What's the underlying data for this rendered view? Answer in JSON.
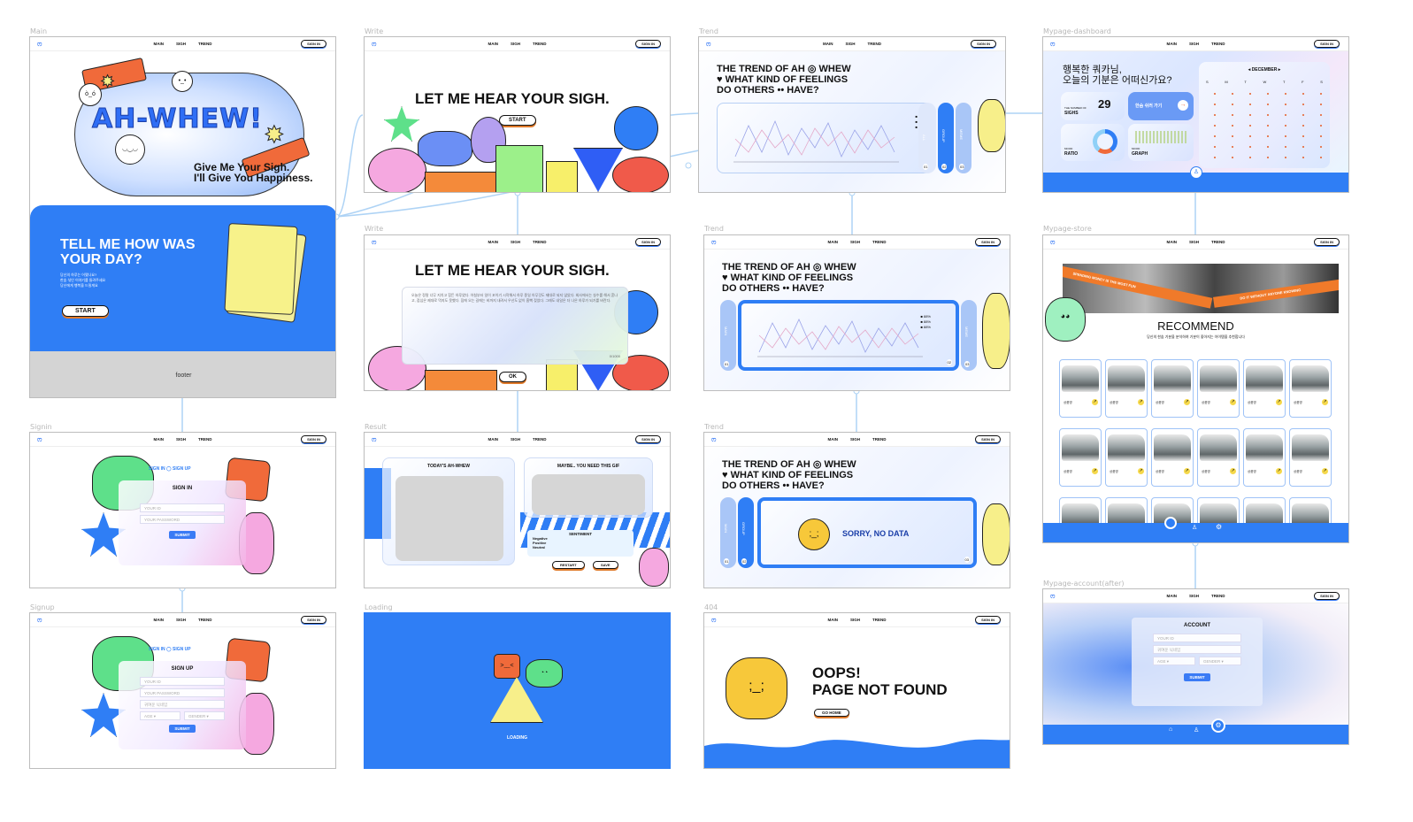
{
  "frame_labels": {
    "main": "Main",
    "write1": "Write",
    "trend1": "Trend",
    "dashboard": "Mypage-dashboard",
    "write2": "Write",
    "trend2": "Trend",
    "store": "Mypage-store",
    "signin": "Signin",
    "result": "Result",
    "trend3": "Trend",
    "signup": "Signup",
    "loading": "Loading",
    "notfound": "404",
    "account": "Mypage-account(after)"
  },
  "nav": {
    "main": "MAIN",
    "sigh": "SIGH",
    "trend": "TREND",
    "sign_in": "SIGN IN"
  },
  "main": {
    "title": "AH-WHEW!",
    "tagline1": "Give Me Your Sigh.",
    "tagline2": "I'll Give You Happiness.",
    "tell1": "TELL ME HOW WAS",
    "tell2": "YOUR DAY?",
    "small1": "당신의 하루는 어땠나요?",
    "small2": "한숨 섞인 이야기를 들려주세요",
    "small3": "당신에게 행복을 드릴게요",
    "start": "START",
    "footer": "footer"
  },
  "write": {
    "title": "LET ME HEAR YOUR SIGH.",
    "start": "START",
    "ok": "OK",
    "counter": "0/1000",
    "body": "오늘은 정말 너무 지치고 힘든 하루였다. 아침부터 일이 꼬이기 시작해서 하루 종일 아무것도 제대로 되지 않았다. 회사에서는 실수를 해서 혼나고, 점심은 제대로 먹지도 못했다. 집에 오는 길에는 비까지 내려서 우산도 없이 흠뻑 젖었다. 그래도 내일은 더 나은 하루가 되기를 바란다."
  },
  "trend": {
    "line1": "THE TREND OF AH",
    "line1b": "WHEW",
    "line2": "WHAT KIND OF FEELINGS",
    "line3": "DO OTHERS",
    "line3b": "HAVE?",
    "tab_all": "ALL",
    "tab_group": "GROUP",
    "tab_meme": "MEME",
    "tab_main": "MAIN",
    "n1": "01",
    "n2": "02",
    "n3": "03",
    "legend": [
      "88%",
      "88%",
      "88%"
    ],
    "nodata": "SORRY, NO DATA"
  },
  "dashboard": {
    "greet1": "행복한 쿼카님,",
    "greet2": "오늘의 기분은 어떠신가요?",
    "month": "DECEMBER",
    "days": [
      "S",
      "M",
      "T",
      "W",
      "T",
      "F",
      "S"
    ],
    "num_label1": "THE NUMBER OF",
    "num_label2": "SIGHS",
    "num": "29",
    "sigh_btn": "한숨 쉬러 가기",
    "ratio1": "MOOD",
    "ratio2": "RATIO",
    "graph1": "MOOD",
    "graph2": "GRAPH"
  },
  "store": {
    "banner_left": "SPENDING MONEY IS THE MOST FUN",
    "banner_right": "DO IT WITHOUT ANYONE KNOWING",
    "title": "RECOMMEND",
    "subtitle": "당신의 한숨 기분을 분석하여 기분이 좋아지는 아이템을 추천합니다",
    "car_label": "상품명"
  },
  "signin": {
    "tab_in": "SIGN IN",
    "tab_up": "SIGN UP",
    "title": "SIGN IN",
    "id": "YOUR ID",
    "pw": "YOUR PASSWORD",
    "submit": "SUBMIT"
  },
  "signup": {
    "tab_in": "SIGN IN",
    "tab_up": "SIGN UP",
    "title": "SIGN UP",
    "id": "YOUR ID",
    "pw": "YOUR PASSWORD",
    "nick": "귀여운 닉네임",
    "age": "AGE",
    "gender": "GENDER",
    "submit": "SUBMIT"
  },
  "result": {
    "today": "TODAY'S AH-WHEW",
    "maybe": "MAYBE.. YOU NEED THIS GIF",
    "sentiment": "SENTIMENT",
    "neg": "Negative",
    "pos": "Positive",
    "neu": "Neutral",
    "restart": "RESTART",
    "save": "SAVE"
  },
  "loading": {
    "text": "LOADING"
  },
  "notfound": {
    "line1": "OOPS!",
    "line2": "PAGE NOT FOUND",
    "go_home": "GO HOME"
  },
  "account": {
    "title": "ACCOUNT",
    "id": "YOUR ID",
    "nick": "귀여운 닉네임",
    "age": "AGE",
    "gender": "GENDER",
    "submit": "SUBMIT"
  },
  "colors": {
    "blue": "#2f7ef5",
    "yellow": "#f7ef8a",
    "green": "#5ee08a",
    "orange": "#f07a3a",
    "purple": "#b4a0f0",
    "pink": "#f5a8e0",
    "red": "#f05a4a",
    "connector": "#aed3f5"
  }
}
